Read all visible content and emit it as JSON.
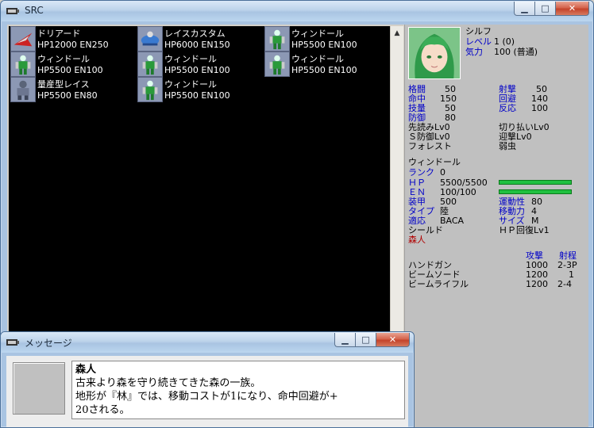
{
  "main_window": {
    "title": "SRC"
  },
  "message_window": {
    "title": "メッセージ",
    "heading": "森人",
    "lines": [
      "古来より森を守り続きてきた森の一族。",
      "地形が『林』では、移動コストが1になり、命中回避が+",
      "20される。"
    ]
  },
  "units": [
    {
      "name": "ドリアード",
      "stats": "HP12000 EN250",
      "icon": "fighter-jet-icon"
    },
    {
      "name": "レイスカスタム",
      "stats": "HP6000 EN150",
      "icon": "blue-mech-icon"
    },
    {
      "name": "ウィンドール",
      "stats": "HP5500 EN100",
      "icon": "green-mech-icon"
    },
    {
      "name": "ウィンドール",
      "stats": "HP5500 EN100",
      "icon": "green-mech-icon"
    },
    {
      "name": "ウィンドール",
      "stats": "HP5500 EN100",
      "icon": "green-mech-icon"
    },
    {
      "name": "ウィンドール",
      "stats": "HP5500 EN100",
      "icon": "green-mech-icon"
    },
    {
      "name": "量産型レイス",
      "stats": "HP5500 EN80",
      "icon": "gray-mech-icon"
    },
    {
      "name": "ウィンドール",
      "stats": "HP5500 EN100",
      "icon": "green-mech-icon"
    }
  ],
  "pilot": {
    "name": "シルフ",
    "level_label": "レベル",
    "level_value": "1 (0)",
    "spirit_label": "気力",
    "spirit_value": "100 (普通)",
    "stats_left": [
      {
        "label": "格闘",
        "value": "50"
      },
      {
        "label": "命中",
        "value": "150"
      },
      {
        "label": "技量",
        "value": "50"
      },
      {
        "label": "防御",
        "value": "80"
      }
    ],
    "stats_right": [
      {
        "label": "射撃",
        "value": "50"
      },
      {
        "label": "回避",
        "value": "140"
      },
      {
        "label": "反応",
        "value": "100"
      }
    ],
    "skills": [
      {
        "left": "先読みLv0",
        "right": "切り払いLv0"
      },
      {
        "left": "Ｓ防御Lv0",
        "right": "迎撃Lv0"
      },
      {
        "left": "フォレスト",
        "right": "弱虫"
      }
    ]
  },
  "unit_detail": {
    "name": "ウィンドール",
    "rank_label": "ランク",
    "rank_value": "0",
    "hp_label": "ＨＰ",
    "hp_value": "5500/5500",
    "hp_fraction": 1.0,
    "en_label": "ＥＮ",
    "en_value": "100/100",
    "en_fraction": 1.0,
    "armor_label": "装甲",
    "armor_value": "500",
    "mobility_label": "運動性",
    "mobility_value": "80",
    "type_label": "タイプ",
    "type_value": "陸",
    "move_label": "移動力",
    "move_value": "4",
    "adapt_label": "適応",
    "adapt_value": "BACA",
    "size_label": "サイズ",
    "size_value": "M",
    "ability_left": "シールド",
    "ability_right": "ＨＰ回復Lv1",
    "feature": "森人"
  },
  "weapons": {
    "header_attack": "攻撃",
    "header_range": "射程",
    "items": [
      {
        "name": "ハンドガン",
        "attack": "1000",
        "range": "2-3P"
      },
      {
        "name": "ビームソード",
        "attack": "1200",
        "range": "1"
      },
      {
        "name": "ビームライフル",
        "attack": "1200",
        "range": "2-4"
      }
    ]
  },
  "colors": {
    "label_blue": "#0000c8",
    "feature_red": "#b00000",
    "bar_green": "#20c040",
    "list_bg": "#000000"
  }
}
